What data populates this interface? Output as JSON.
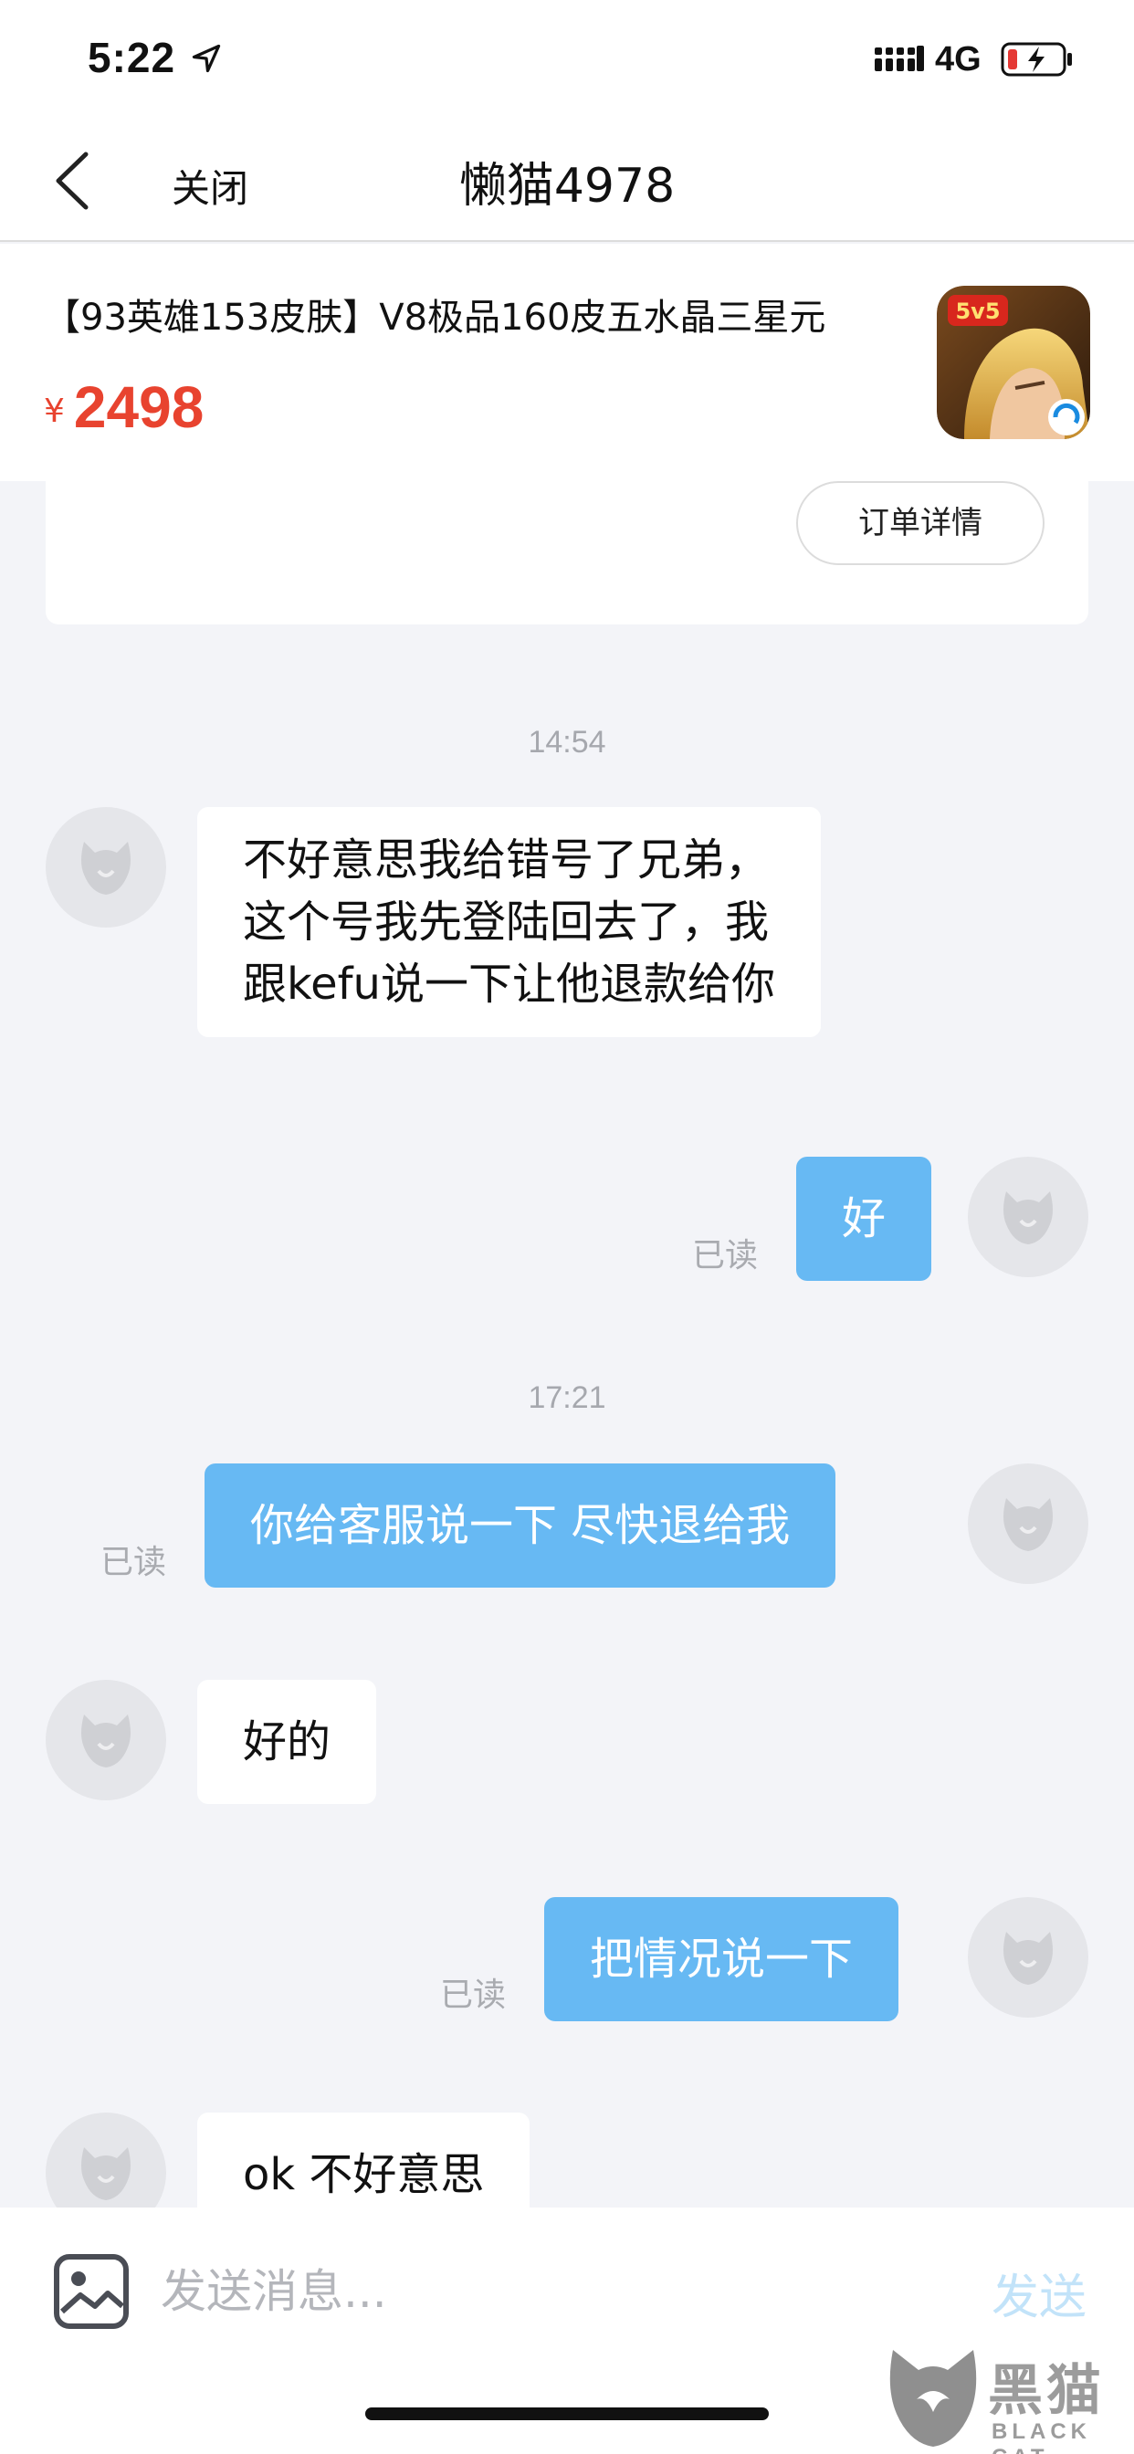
{
  "status_bar": {
    "time": "5:22",
    "network": "4G"
  },
  "nav": {
    "close_label": "关闭",
    "title": "懒猫4978"
  },
  "product": {
    "title": "【93英雄153皮肤】V8极品160皮五水晶三星元",
    "currency_symbol": "¥",
    "price": "2498",
    "icon_badge": "5v5"
  },
  "order": {
    "detail_button": "订单详情"
  },
  "messages": {
    "timestamp_1": "14:54",
    "msg_1": "不好意思我给错号了兄弟，\n这个号我先登陆回去了，我\n跟kefu说一下让他退款给你",
    "msg_2": "好",
    "msg_2_status": "已读",
    "timestamp_2": "17:21",
    "msg_3": "你给客服说一下 尽快退给我",
    "msg_3_status": "已读",
    "msg_4": "好的",
    "msg_5": "把情况说一下",
    "msg_5_status": "已读",
    "msg_6": "ok 不好意思"
  },
  "input": {
    "placeholder": "发送消息...",
    "send_label": "发送"
  },
  "watermark": {
    "name": "黑猫",
    "sub": "BLACK CAT"
  },
  "colors": {
    "accent_blue": "#67b9f3",
    "price_red": "#e8432f",
    "background": "#f3f4f8"
  }
}
